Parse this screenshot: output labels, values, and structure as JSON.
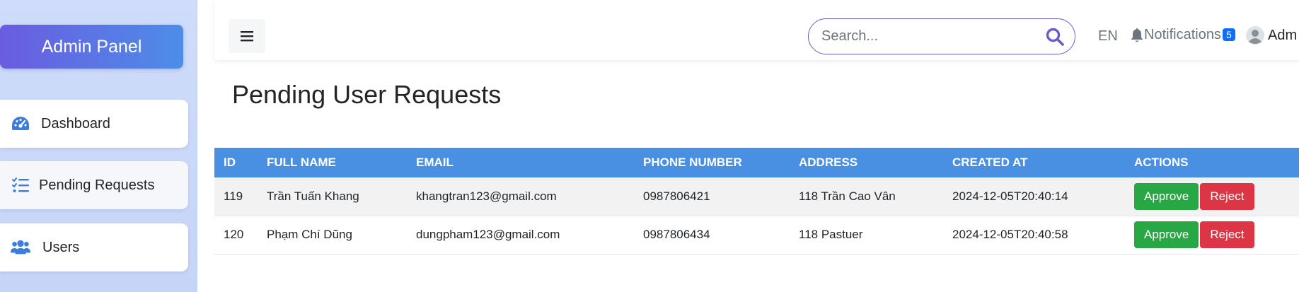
{
  "sidebar": {
    "brand": "Admin Panel",
    "items": [
      {
        "label": "Dashboard",
        "icon": "tachometer-icon"
      },
      {
        "label": "Pending Requests",
        "icon": "list-check-icon"
      },
      {
        "label": "Users",
        "icon": "users-icon"
      }
    ]
  },
  "topbar": {
    "search_placeholder": "Search...",
    "language": "EN",
    "notifications_label": "Notifications",
    "notifications_count": "5",
    "user_label": "Adm"
  },
  "main": {
    "title": "Pending User Requests",
    "table": {
      "headers": [
        "ID",
        "FULL NAME",
        "EMAIL",
        "PHONE NUMBER",
        "ADDRESS",
        "CREATED AT",
        "ACTIONS"
      ],
      "rows": [
        {
          "id": "119",
          "full_name": "Trần Tuấn Khang",
          "email": "khangtran123@gmail.com",
          "phone": "0987806421",
          "address": "118 Trần Cao Vân",
          "created_at": "2024-12-05T20:40:14"
        },
        {
          "id": "120",
          "full_name": "Phạm Chí Dũng",
          "email": "dungpham123@gmail.com",
          "phone": "0987806434",
          "address": "118 Pastuer",
          "created_at": "2024-12-05T20:40:58"
        }
      ],
      "approve_label": "Approve",
      "reject_label": "Reject"
    }
  },
  "colors": {
    "brand_gradient_start": "#6a5ce0",
    "brand_gradient_end": "#4d8de8",
    "table_header": "#4a90e2",
    "approve": "#28a745",
    "reject": "#dc3545",
    "icon_blue": "#3b7ddd",
    "search_accent": "#6f58c9",
    "badge": "#0d6efd"
  }
}
